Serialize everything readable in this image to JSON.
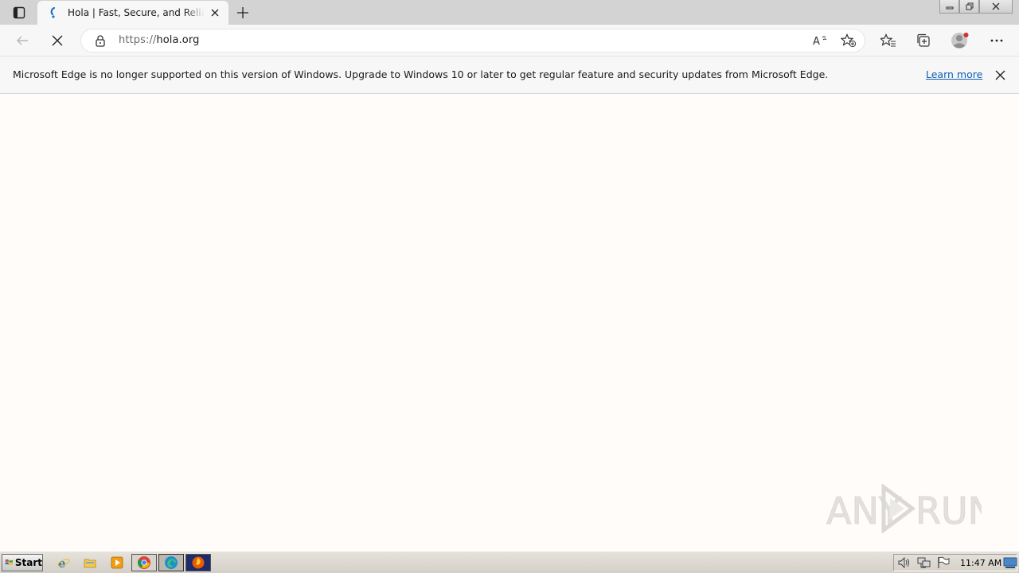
{
  "window": {
    "tab_title": "Hola | Fast, Secure, and Reliable F",
    "icons": [
      "tab-actions-icon",
      "hola-favicon",
      "close-icon",
      "plus-icon",
      "minimize-icon",
      "restore-icon",
      "close-window-icon"
    ]
  },
  "toolbar": {
    "url_scheme": "https://",
    "url_host": "hola.org",
    "icons": [
      "back-arrow-icon",
      "stop-loading-icon",
      "lock-icon",
      "read-aloud-icon",
      "add-favorite-icon",
      "favorites-icon",
      "collections-icon",
      "profile-avatar-icon",
      "more-menu-icon"
    ]
  },
  "infobar": {
    "message": "Microsoft Edge is no longer supported on this version of Windows. Upgrade to Windows 10 or later to get regular feature and security updates from Microsoft Edge.",
    "link": "Learn more"
  },
  "watermark": {
    "text": "ANY RUN"
  },
  "taskbar": {
    "start_label": "Start",
    "clock": "11:47 AM",
    "apps": [
      "internet-explorer-icon",
      "file-explorer-icon",
      "media-player-icon",
      "chrome-icon",
      "edge-icon",
      "firefox-icon"
    ]
  },
  "colors": {
    "link": "#0a5fb4",
    "page_bg": "#fffcf9",
    "chrome_bg": "#f7f7f7",
    "titlebar_bg": "#d3d3d3"
  }
}
